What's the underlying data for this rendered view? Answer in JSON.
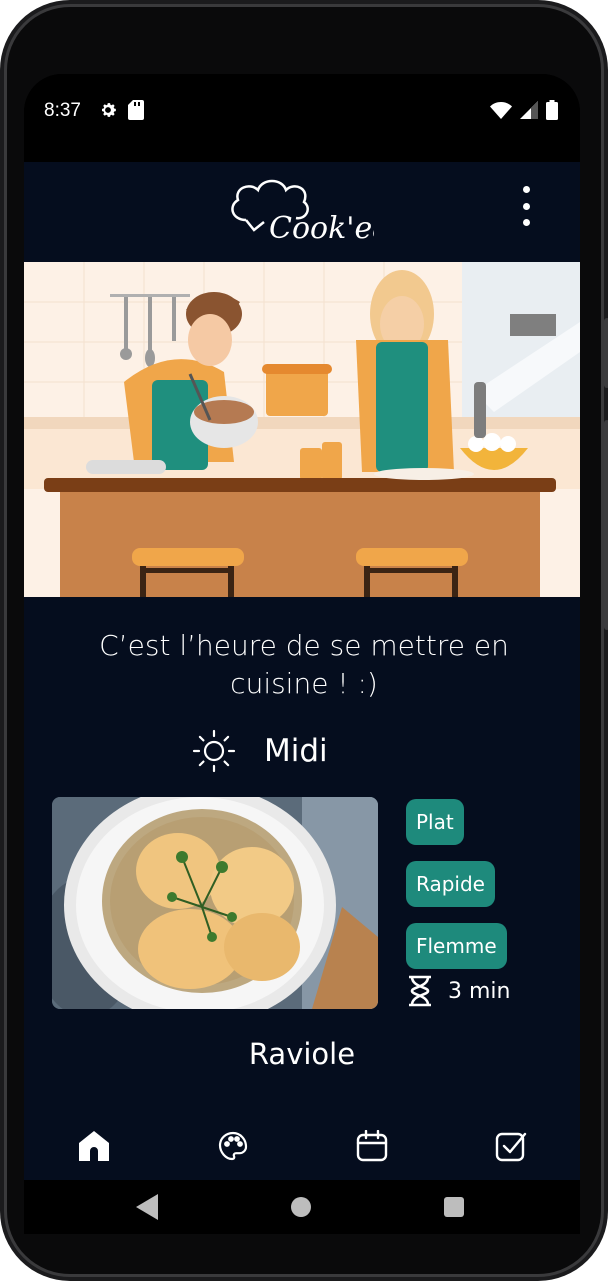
{
  "status_bar": {
    "time": "8:37",
    "left_icons": [
      "settings-icon",
      "sd-card-icon"
    ],
    "right_icons": [
      "wifi-icon",
      "signal-icon",
      "battery-icon"
    ]
  },
  "app_bar": {
    "logo_text": "Cook'eat",
    "menu_icon": "more-vert-icon"
  },
  "hero": {
    "illustration": "two people cooking in kitchen"
  },
  "main": {
    "headline": "C’est l’heure de se mettre en cuisine ! :)",
    "meal_icon": "sun-icon",
    "meal_label": "Midi",
    "recipe": {
      "name": "Raviole",
      "tags": [
        "Plat",
        "Rapide",
        "Flemme"
      ],
      "time": "3 min",
      "time_icon": "hourglass-icon"
    }
  },
  "bottom_nav": {
    "items": [
      {
        "icon": "home-icon",
        "active": true
      },
      {
        "icon": "palette-icon",
        "active": false
      },
      {
        "icon": "calendar-icon",
        "active": false
      },
      {
        "icon": "checkbox-icon",
        "active": false
      }
    ]
  },
  "system_nav": [
    "back-icon",
    "home-circle-icon",
    "recents-icon"
  ],
  "colors": {
    "background": "#050d1e",
    "tag": "#1e8a7c",
    "text": "#ffffff"
  }
}
